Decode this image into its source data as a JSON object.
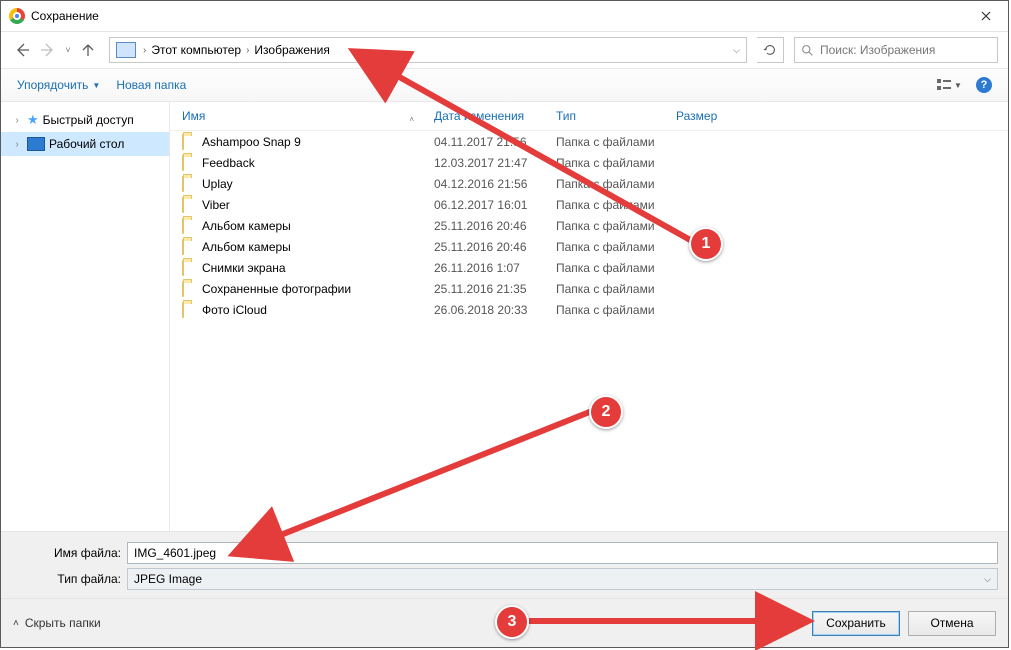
{
  "window": {
    "title": "Сохранение"
  },
  "nav": {
    "breadcrumb_root": "Этот компьютер",
    "breadcrumb_current": "Изображения",
    "search_placeholder": "Поиск: Изображения"
  },
  "toolbar": {
    "organize": "Упорядочить",
    "new_folder": "Новая папка"
  },
  "sidebar": {
    "quick_access": "Быстрый доступ",
    "desktop": "Рабочий стол"
  },
  "columns": {
    "name": "Имя",
    "modified": "Дата изменения",
    "type": "Тип",
    "size": "Размер"
  },
  "type_folder": "Папка с файлами",
  "rows": [
    {
      "name": "Ashampoo Snap 9",
      "date": "04.11.2017 21:56"
    },
    {
      "name": "Feedback",
      "date": "12.03.2017 21:47"
    },
    {
      "name": "Uplay",
      "date": "04.12.2016 21:56"
    },
    {
      "name": "Viber",
      "date": "06.12.2017 16:01"
    },
    {
      "name": "Альбом камеры",
      "date": "25.11.2016 20:46"
    },
    {
      "name": "Альбом камеры",
      "date": "25.11.2016 20:46"
    },
    {
      "name": "Снимки экрана",
      "date": "26.11.2016 1:07"
    },
    {
      "name": "Сохраненные фотографии",
      "date": "25.11.2016 21:35"
    },
    {
      "name": "Фото iCloud",
      "date": "26.06.2018 20:33"
    }
  ],
  "form": {
    "filename_label": "Имя файла:",
    "filename_value": "IMG_4601.jpeg",
    "filetype_label": "Тип файла:",
    "filetype_value": "JPEG Image"
  },
  "actions": {
    "hide_folders": "Скрыть папки",
    "save": "Сохранить",
    "cancel": "Отмена"
  },
  "annotations": {
    "m1": "1",
    "m2": "2",
    "m3": "3"
  }
}
